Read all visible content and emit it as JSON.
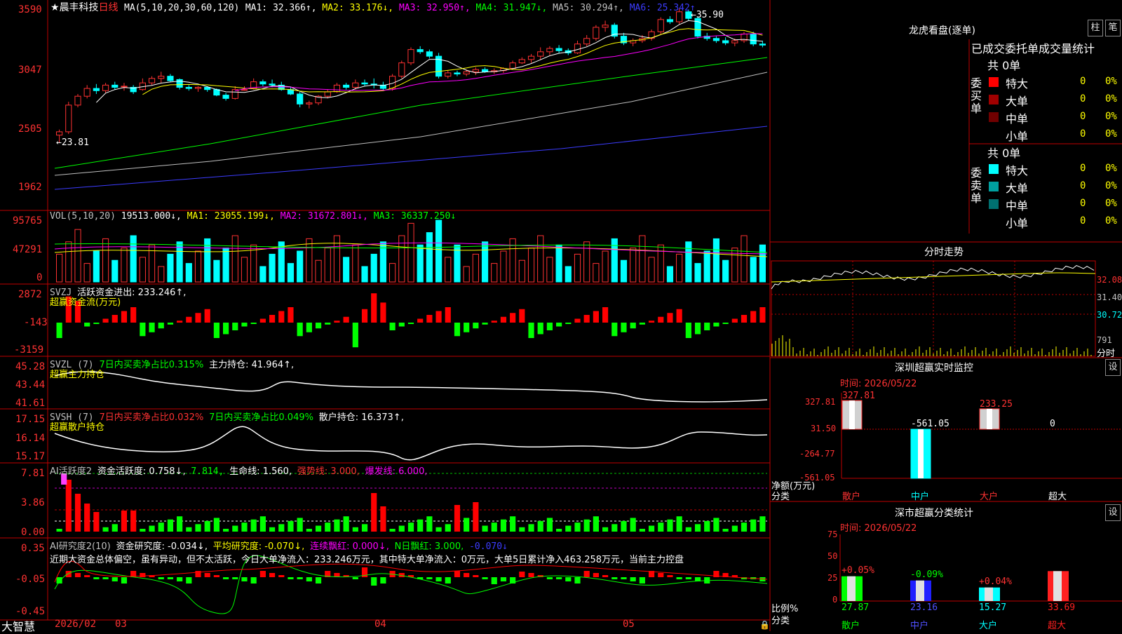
{
  "stock": {
    "star": "★",
    "name": "晨丰科技",
    "period": "日线"
  },
  "price_ind": {
    "label": "MA(5,10,20,30,60,120)",
    "items": [
      {
        "t": "MA1: 32.366↑,",
        "c": "#ffffff"
      },
      {
        "t": "MA2: 33.176↓,",
        "c": "#ffff00"
      },
      {
        "t": "MA3: 32.950↑,",
        "c": "#ff00ff"
      },
      {
        "t": "MA4: 31.947↓,",
        "c": "#00ff00"
      },
      {
        "t": "MA5: 30.294↑,",
        "c": "#c0c0c0"
      },
      {
        "t": "MA6: 25.342↑",
        "c": "#3c3cff"
      }
    ],
    "high_note": "35.90",
    "low_note": "23.81"
  },
  "price_axis": [
    "3590",
    "3047",
    "2505",
    "1962"
  ],
  "vol_ind": {
    "label": "VOL(5,10,20)",
    "value": "19513.000↓,",
    "items": [
      {
        "t": "MA1: 23055.199↓,",
        "c": "#ffff00"
      },
      {
        "t": "MA2: 31672.801↓,",
        "c": "#ff00ff"
      },
      {
        "t": "MA3: 36337.250↓",
        "c": "#00ff00"
      }
    ]
  },
  "vol_axis": [
    "95765",
    "47291",
    "0"
  ],
  "svzj": {
    "label": "SVZJ",
    "desc": "活跃资金进出: 233.246↑,",
    "sub": "超赢资金流(万元)"
  },
  "svzj_axis": [
    "2872",
    "-143",
    "-3159"
  ],
  "svzl": {
    "label": "SVZL (7)",
    "d1": "7日内买卖净占比0.315%",
    "d2": "主力持仓: 41.964↑,",
    "sub": "超赢主力持仓"
  },
  "svzl_axis": [
    "45.28",
    "43.44",
    "41.61"
  ],
  "svsh": {
    "label": "SVSH (7)",
    "d1": "7日内买卖净占比0.032%",
    "d2": "7日内买卖净占比0.049%",
    "d3": "散户持仓: 16.373↑,",
    "sub": "超赢散户持仓"
  },
  "svsh_axis": [
    "17.15",
    "16.14",
    "15.17"
  ],
  "ai2": {
    "label": "AI活跃度2",
    "d1": "资金活跃度: 0.758↓,",
    "d2": "7.814,",
    "d3": "生命线: 1.560,",
    "d4": "强势线: 3.000,",
    "d5": "爆发线: 6.000,"
  },
  "ai2_axis": [
    "7.81",
    "3.86",
    "0.00"
  ],
  "ai_research": {
    "label": "AI研究度2(10)",
    "d1": "资金研究度: -0.034↓,",
    "d2": "平均研究度: -0.070↓,",
    "d3": "连续飘红: 0.000↓,",
    "d4": "N日飘红: 3.000,",
    "d5": "-0.070↓",
    "comment": "近期大资金总体偏空，虽有异动，但不太活跃，今日大单净流入：233.246万元，其中特大单净流入：0万元，大单5日累计净入463.258万元，当前主力控盘"
  },
  "research_axis": [
    "0.35",
    "-0.05",
    "-0.45"
  ],
  "bottom": {
    "brand": "大智慧",
    "dates": [
      "2026/02",
      "03",
      "04",
      "05"
    ]
  },
  "dragon": {
    "title": "龙虎看盘(逐单)",
    "btn1": "柱",
    "btn2": "笔",
    "header": "已成交委托单成交量统计",
    "buy": {
      "side": "委买单",
      "total": "共 0单",
      "rows": [
        {
          "name": "特大",
          "v": "0",
          "p": "0%",
          "c": "#ff0000"
        },
        {
          "name": "大单",
          "v": "0",
          "p": "0%",
          "c": "#a00000"
        },
        {
          "name": "中单",
          "v": "0",
          "p": "0%",
          "c": "#700000"
        },
        {
          "name": "小单",
          "v": "0",
          "p": "0%",
          "c": "#000000"
        }
      ]
    },
    "sell": {
      "side": "委卖单",
      "total": "共 0单",
      "rows": [
        {
          "name": "特大",
          "v": "0",
          "p": "0%",
          "c": "#00ffff"
        },
        {
          "name": "大单",
          "v": "0",
          "p": "0%",
          "c": "#00a0a0"
        },
        {
          "name": "中单",
          "v": "0",
          "p": "0%",
          "c": "#007070"
        },
        {
          "name": "小单",
          "v": "0",
          "p": "0%",
          "c": "#000000"
        }
      ]
    }
  },
  "timeshare": {
    "title": "分时走势",
    "p1": "32.08",
    "p2": "31.40",
    "p3": "30.72",
    "vol": "791",
    "unit": "分时"
  },
  "sz_monitor": {
    "title": "深圳超赢实时监控",
    "btn": "设",
    "time": "时间: 2026/05/22",
    "axis": [
      "327.81",
      "31.50",
      "-264.77",
      "-561.05"
    ],
    "bars": [
      {
        "cat": "散户",
        "val": "327.81"
      },
      {
        "cat": "中户",
        "val": "-561.05"
      },
      {
        "cat": "大户",
        "val": "233.25"
      },
      {
        "cat": "超大",
        "val": "0"
      }
    ],
    "ylabel": "净额(万元)",
    "xlabel": "分类"
  },
  "sz_class": {
    "title": "深市超赢分类统计",
    "btn": "设",
    "time": "时间: 2026/05/22",
    "axis": [
      "75",
      "50",
      "25",
      "0"
    ],
    "bars": [
      {
        "cat": "散户",
        "val": "27.87",
        "chg": "+0.05%",
        "cc": "#ff3232",
        "fill": "#00ff00"
      },
      {
        "cat": "中户",
        "val": "23.16",
        "chg": "-0.09%",
        "cc": "#00ff00",
        "fill": "#2020ff"
      },
      {
        "cat": "大户",
        "val": "15.27",
        "chg": "+0.04%",
        "cc": "#ff3232",
        "fill": "#00ffff"
      },
      {
        "cat": "超大",
        "val": "33.69",
        "chg": "",
        "cc": "#ff3232",
        "fill": "#ff2020"
      }
    ],
    "ylabel": "比例%",
    "xlabel": "分类"
  },
  "chart_data": {
    "type": "candlestick",
    "candles": [
      [
        24.5,
        25.0,
        23.8,
        24.8
      ],
      [
        24.8,
        27.5,
        24.6,
        27.2
      ],
      [
        27.2,
        28.2,
        27.0,
        28.0
      ],
      [
        28.0,
        29.0,
        27.8,
        28.7
      ],
      [
        28.7,
        29.1,
        28.2,
        28.5
      ],
      [
        28.5,
        29.2,
        28.3,
        29.0
      ],
      [
        29.0,
        29.3,
        28.6,
        28.8
      ],
      [
        28.9,
        29.2,
        28.5,
        28.9
      ],
      [
        28.8,
        29.0,
        28.2,
        28.4
      ],
      [
        28.6,
        29.6,
        28.5,
        29.2
      ],
      [
        29.2,
        29.8,
        29.0,
        29.6
      ],
      [
        29.6,
        30.2,
        29.2,
        29.8
      ],
      [
        29.8,
        30.0,
        29.3,
        29.4
      ],
      [
        29.5,
        29.6,
        28.6,
        28.8
      ],
      [
        28.8,
        29.0,
        28.5,
        28.7
      ],
      [
        28.7,
        28.9,
        28.4,
        28.8
      ],
      [
        28.8,
        28.9,
        28.4,
        28.6
      ],
      [
        28.6,
        28.7,
        28.0,
        28.1
      ],
      [
        28.1,
        28.3,
        27.6,
        27.8
      ],
      [
        27.8,
        28.9,
        27.7,
        28.6
      ],
      [
        28.6,
        28.9,
        28.5,
        28.6
      ],
      [
        28.7,
        29.6,
        28.6,
        29.3
      ],
      [
        29.3,
        29.5,
        28.9,
        29.1
      ],
      [
        29.1,
        29.5,
        28.8,
        29.0
      ],
      [
        29.0,
        29.3,
        28.5,
        28.6
      ],
      [
        28.6,
        28.8,
        28.1,
        28.2
      ],
      [
        28.2,
        28.4,
        27.0,
        27.3
      ],
      [
        27.3,
        27.6,
        26.9,
        27.4
      ],
      [
        27.4,
        28.1,
        27.2,
        28.0
      ],
      [
        28.0,
        28.6,
        27.8,
        28.4
      ],
      [
        28.4,
        29.2,
        28.3,
        29.0
      ],
      [
        29.0,
        29.2,
        28.6,
        28.8
      ],
      [
        28.8,
        29.5,
        28.6,
        29.2
      ],
      [
        29.2,
        29.5,
        28.9,
        29.1
      ],
      [
        29.1,
        29.6,
        28.7,
        29.0
      ],
      [
        29.0,
        29.3,
        28.5,
        28.7
      ],
      [
        28.7,
        30.0,
        28.5,
        29.8
      ],
      [
        29.8,
        31.2,
        29.6,
        31.0
      ],
      [
        31.0,
        32.4,
        30.8,
        32.2
      ],
      [
        32.2,
        32.5,
        31.8,
        32.0
      ],
      [
        32.0,
        32.2,
        31.4,
        31.6
      ],
      [
        31.6,
        31.9,
        29.6,
        29.8
      ],
      [
        29.8,
        30.3,
        29.6,
        30.1
      ],
      [
        30.1,
        30.3,
        29.8,
        30.0
      ],
      [
        30.0,
        30.4,
        29.8,
        30.2
      ],
      [
        30.2,
        30.6,
        29.9,
        30.4
      ],
      [
        30.4,
        30.6,
        30.1,
        30.2
      ],
      [
        30.2,
        30.5,
        30.0,
        30.3
      ],
      [
        30.3,
        30.6,
        30.1,
        30.5
      ],
      [
        30.5,
        31.2,
        30.4,
        31.0
      ],
      [
        31.0,
        31.5,
        30.9,
        31.3
      ],
      [
        31.3,
        31.8,
        31.0,
        31.6
      ],
      [
        31.6,
        32.4,
        31.3,
        32.0
      ],
      [
        32.0,
        32.5,
        31.7,
        32.3
      ],
      [
        32.3,
        32.6,
        31.9,
        32.1
      ],
      [
        32.1,
        32.3,
        31.7,
        31.9
      ],
      [
        31.9,
        33.0,
        31.8,
        32.7
      ],
      [
        32.7,
        33.5,
        32.5,
        33.2
      ],
      [
        33.2,
        34.4,
        33.0,
        34.2
      ],
      [
        34.2,
        34.8,
        33.8,
        34.4
      ],
      [
        34.4,
        34.6,
        33.2,
        33.4
      ],
      [
        33.4,
        33.7,
        32.6,
        32.8
      ],
      [
        32.8,
        33.2,
        32.5,
        33.0
      ],
      [
        33.0,
        33.5,
        32.8,
        33.2
      ],
      [
        33.2,
        34.0,
        33.0,
        33.8
      ],
      [
        33.8,
        35.1,
        33.6,
        34.9
      ],
      [
        34.9,
        35.2,
        34.5,
        34.7
      ],
      [
        34.7,
        35.9,
        34.5,
        35.6
      ],
      [
        35.6,
        35.8,
        34.8,
        35.0
      ],
      [
        35.0,
        35.2,
        33.2,
        33.4
      ],
      [
        33.4,
        33.7,
        33.0,
        33.2
      ],
      [
        33.2,
        33.4,
        32.8,
        33.0
      ],
      [
        33.0,
        33.3,
        32.6,
        32.8
      ],
      [
        32.8,
        33.2,
        32.5,
        33.0
      ],
      [
        33.0,
        33.8,
        32.8,
        33.6
      ],
      [
        33.6,
        33.8,
        32.5,
        32.7
      ],
      [
        32.7,
        33.0,
        32.4,
        32.6
      ]
    ],
    "ma_series": [
      {
        "name": "MA1",
        "last": 32.366
      },
      {
        "name": "MA2",
        "last": 33.176
      },
      {
        "name": "MA3",
        "last": 32.95
      },
      {
        "name": "MA4",
        "last": 31.947
      },
      {
        "name": "MA5",
        "last": 30.294
      },
      {
        "name": "MA6",
        "last": 25.342
      }
    ],
    "ylim": [
      19.62,
      35.9
    ]
  }
}
